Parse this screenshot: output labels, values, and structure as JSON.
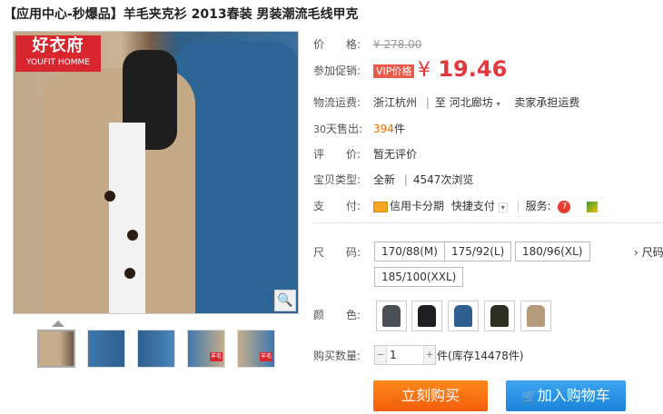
{
  "title": "【应用中心-秒爆品】羊毛夹克衫 2013春装 男装潮流毛线甲克",
  "brand": {
    "cn": "好衣府",
    "en": "YOUFIT HOMME"
  },
  "thumbnails": [
    {
      "name": "khaki",
      "badge": ""
    },
    {
      "name": "blue",
      "badge": ""
    },
    {
      "name": "blue-2",
      "badge": ""
    },
    {
      "name": "mix",
      "badge": "羊毛"
    },
    {
      "name": "mix-2",
      "badge": "羊毛"
    }
  ],
  "fields": {
    "price_label": "价　　格:",
    "price_original": "¥ 278.00",
    "promo_label": "参加促销:",
    "vip_tag": "VIP价格",
    "promo_currency": "¥",
    "promo_price": "19.46",
    "shipping_label": "物流运费:",
    "shipping_from": "浙江杭州",
    "shipping_to_label": "至",
    "shipping_to": "河北廊坊",
    "shipping_note": "卖家承担运费",
    "sold_label_days": "30",
    "sold_label": "天售出:",
    "sold_count": "394",
    "sold_unit": "件",
    "review_label": "评　　价:",
    "review_value": "暂无评价",
    "type_label": "宝贝类型:",
    "type_value": "全新",
    "views": "4547次浏览",
    "pay_label": "支　　付:",
    "pay_credit": "信用卡分期",
    "pay_quick": "快捷支付",
    "service_label": "服务:"
  },
  "size_label": "尺　　码:",
  "sizes": [
    "170/88(M)",
    "175/92(L)",
    "180/96(XL)",
    "185/100(XXL)"
  ],
  "size_more": "› 尺码",
  "color_label": "颜　　色:",
  "swatch_colors": [
    "#4a4f55",
    "#1f1f22",
    "#2f5f8e",
    "#2b3020",
    "#b59b7c"
  ],
  "quantity": {
    "label": "购买数量:",
    "minus": "−",
    "value": "1",
    "plus": "+",
    "unit": "件",
    "stock": "(库存14478件)"
  },
  "buttons": {
    "buy": "立刻购买",
    "cart": "加入购物车"
  },
  "zoom_glyph": "🔍",
  "colors": {
    "accent_red": "#e4393c",
    "buy_orange": "#f45d0b",
    "cart_blue": "#1b84d8",
    "brand_red": "#d8262f"
  }
}
